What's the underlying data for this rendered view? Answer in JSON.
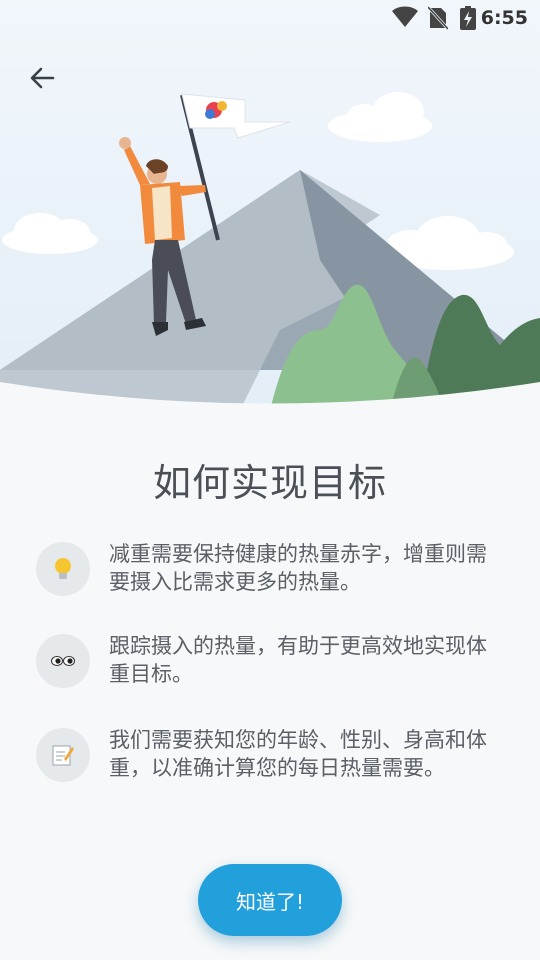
{
  "status_bar": {
    "time": "6:55",
    "icons": [
      "wifi-icon",
      "no-sim-icon",
      "battery-charging-icon"
    ]
  },
  "header": {
    "back_icon": "arrow-left-icon"
  },
  "hero": {
    "illustration": "person-with-flag-on-mountain",
    "colors": {
      "sky": "#eaf3fb",
      "mountain": "#9aa8b3",
      "green": "#8cc08e",
      "dark_green": "#4f7a58"
    }
  },
  "main": {
    "title": "如何实现目标",
    "tips": [
      {
        "icon": "lightbulb-icon",
        "text": "减重需要保持健康的热量赤字，增重则需要摄入比需求更多的热量。"
      },
      {
        "icon": "eyes-icon",
        "text": "跟踪摄入的热量，有助于更高效地实现体重目标。"
      },
      {
        "icon": "memo-icon",
        "text": "我们需要获知您的年龄、性别、身高和体重，以准确计算您的每日热量需要。"
      }
    ]
  },
  "footer": {
    "button_label": "知道了!",
    "accent_color": "#22a0dc"
  }
}
